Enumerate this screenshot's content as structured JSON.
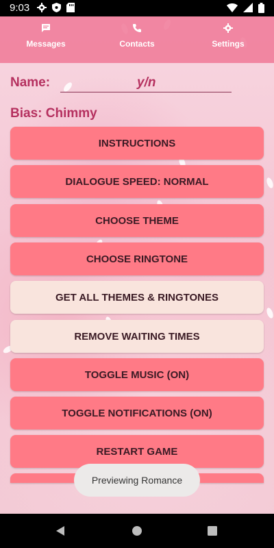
{
  "status_bar": {
    "time": "9:03",
    "left_icons": [
      "gear-icon",
      "shield-icon",
      "sd-card-icon"
    ],
    "right_icons": [
      "wifi-icon",
      "signal-icon",
      "battery-icon"
    ]
  },
  "top_nav": {
    "tabs": [
      {
        "label": "Messages",
        "icon": "message-icon"
      },
      {
        "label": "Contacts",
        "icon": "phone-icon"
      },
      {
        "label": "Settings",
        "icon": "gear-icon"
      }
    ]
  },
  "profile": {
    "name_label": "Name:",
    "name_value": "y/n",
    "bias_label": "Bias: Chimmy"
  },
  "buttons": [
    {
      "label": "INSTRUCTIONS"
    },
    {
      "label": "DIALOGUE SPEED: NORMAL"
    },
    {
      "label": "CHOOSE THEME"
    },
    {
      "label": "CHOOSE RINGTONE"
    },
    {
      "label": "GET ALL THEMES & RINGTONES"
    },
    {
      "label": "REMOVE WAITING TIMES"
    },
    {
      "label": "TOGGLE MUSIC (ON)"
    },
    {
      "label": "TOGGLE NOTIFICATIONS (ON)"
    },
    {
      "label": "RESTART GAME"
    }
  ],
  "toast": {
    "text": "Previewing Romance"
  },
  "colors": {
    "button": "#ff7a86",
    "button_light": "#f9e4dd",
    "accent_text": "#b5305f",
    "nav": "#f07896"
  },
  "nav_bar": {
    "icons": [
      "back-icon",
      "home-icon",
      "recents-icon"
    ]
  }
}
